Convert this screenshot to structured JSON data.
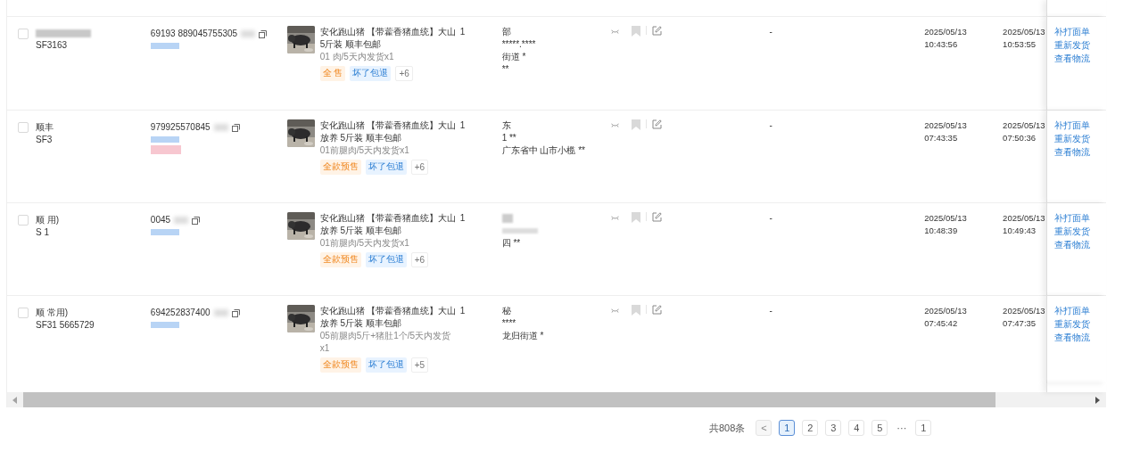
{
  "orders": [
    {
      "checked": false,
      "waybill": "SF3163",
      "order_no": "69193 889045755305",
      "order_masks": [
        {
          "color": "#b8d4f5"
        }
      ],
      "product": {
        "title": "安化跑山猪 【带藿香猪血统】大山",
        "subtitle": "5斤装 顺丰包邮",
        "spec": "01 肉/5天内发货x1",
        "tags": [
          {
            "text": "全 售",
            "kind": "orange"
          },
          {
            "text": "坏了包退",
            "kind": "blue"
          },
          {
            "text": "+6",
            "kind": "more"
          }
        ]
      },
      "qty": "1",
      "receiver": {
        "name": "部",
        "phone": "*****.****",
        "address": "街道 *",
        "extra": "**"
      },
      "flagged": false,
      "remark": "-",
      "created": "2025/05/13",
      "created_time": "10:43:56",
      "paid": "2025/05/13",
      "paid_time": "10:53:55",
      "actions": [
        "补打面单",
        "重新发货",
        "查看物流"
      ]
    },
    {
      "checked": false,
      "carrier": "顺丰",
      "waybill": "SF3",
      "order_no": "979925570845",
      "order_masks": [
        {
          "color": "#b8d4f5"
        },
        {
          "color": "#f7c7d0"
        }
      ],
      "product": {
        "title": "安化跑山猪 【带藿香猪血统】大山",
        "subtitle": "放养 5斤装 顺丰包邮",
        "spec": "01前腿肉/5天内发货x1",
        "tags": [
          {
            "text": "全款预售",
            "kind": "orange"
          },
          {
            "text": "坏了包退",
            "kind": "blue"
          },
          {
            "text": "+6",
            "kind": "more"
          }
        ]
      },
      "qty": "1",
      "receiver": {
        "name": "东",
        "phone": "1 **",
        "address": "广东省中 山市小榄 **"
      },
      "flagged": false,
      "remark": "-",
      "created": "2025/05/13",
      "created_time": "07:43:35",
      "paid": "2025/05/13",
      "paid_time": "07:50:36",
      "actions": [
        "补打面单",
        "重新发货",
        "查看物流"
      ]
    },
    {
      "checked": false,
      "carrier": "顺 用)",
      "waybill": "S 1",
      "order_no": "0045",
      "order_masks": [
        {
          "color": "#b8d4f5"
        }
      ],
      "product": {
        "title": "安化跑山猪 【带藿香猪血统】大山",
        "subtitle": "放养 5斤装 顺丰包邮",
        "spec": "01前腿肉/5天内发货x1",
        "tags": [
          {
            "text": "全款预售",
            "kind": "orange"
          },
          {
            "text": "坏了包退",
            "kind": "blue"
          },
          {
            "text": "+6",
            "kind": "more"
          }
        ]
      },
      "qty": "1",
      "receiver": {
        "address": "四 **"
      },
      "flagged": false,
      "remark": "-",
      "created": "2025/05/13",
      "created_time": "10:48:39",
      "paid": "2025/05/13",
      "paid_time": "10:49:43",
      "actions": [
        "补打面单",
        "重新发货",
        "查看物流"
      ]
    },
    {
      "checked": false,
      "carrier": "顺 常用)",
      "waybill": "SF31 5665729",
      "order_no": "694252837400",
      "order_masks": [
        {
          "color": "#b8d4f5"
        }
      ],
      "product": {
        "title": "安化跑山猪 【带藿香猪血统】大山",
        "subtitle": "放养 5斤装 顺丰包邮",
        "spec": "05前腿肉5斤+猪肚1个/5天内发货x1",
        "tags": [
          {
            "text": "全款预售",
            "kind": "orange"
          },
          {
            "text": "坏了包退",
            "kind": "blue"
          },
          {
            "text": "+5",
            "kind": "more"
          }
        ]
      },
      "qty": "1",
      "receiver": {
        "name": "秘",
        "phone": "****",
        "address": "龙归街道 *"
      },
      "flagged": false,
      "remark": "-",
      "created": "2025/05/13",
      "created_time": "07:45:42",
      "paid": "2025/05/13",
      "paid_time": "07:47:35",
      "actions": [
        "补打面单",
        "重新发货",
        "查看物流"
      ]
    }
  ],
  "pagination": {
    "total": "共808条",
    "prev": {
      "text": "<",
      "disabled": true
    },
    "pages": [
      {
        "text": "1",
        "selected": true
      },
      {
        "text": "2",
        "selected": false
      },
      {
        "text": "3",
        "selected": false
      },
      {
        "text": "4",
        "selected": false
      },
      {
        "text": "5",
        "selected": false
      }
    ],
    "ellipsis": "···",
    "last": "1"
  }
}
